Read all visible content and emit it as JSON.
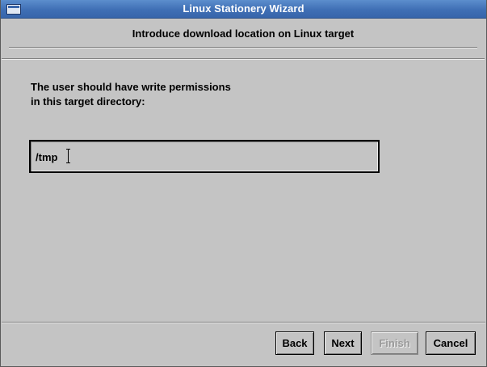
{
  "window": {
    "title": "Linux Stationery Wizard"
  },
  "page": {
    "header_title": "Introduce download location on Linux target",
    "instruction_line1": "The user should have write permissions",
    "instruction_line2": "in this target directory:"
  },
  "path_field": {
    "value": "/tmp"
  },
  "buttons": {
    "back": "Back",
    "next": "Next",
    "finish": "Finish",
    "cancel": "Cancel",
    "finish_enabled": false
  },
  "colors": {
    "titlebar": "#3f6fb5",
    "background": "#c4c4c4",
    "title_text": "#ffffff"
  },
  "icons": {
    "window_menu": "window-menu-icon",
    "text_cursor": "i-beam-cursor-icon"
  }
}
